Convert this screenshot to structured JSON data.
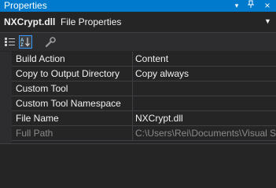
{
  "titlebar": {
    "title": "Properties",
    "menu_glyph": "▾",
    "pin_glyph": "⊥",
    "close_glyph": "×"
  },
  "selector": {
    "object_name": "NXCrypt.dll",
    "object_type": "File Properties",
    "dropdown_glyph": "▼"
  },
  "toolbar": {
    "tools": [
      "categorized-icon",
      "alphabetical-icon",
      "property-pages-icon"
    ],
    "active_tool": "alphabetical-icon",
    "active_color": "#3399ff"
  },
  "properties": [
    {
      "name": "Build Action",
      "value": "Content"
    },
    {
      "name": "Copy to Output Directory",
      "value": "Copy always"
    },
    {
      "name": "Custom Tool",
      "value": ""
    },
    {
      "name": "Custom Tool Namespace",
      "value": ""
    },
    {
      "name": "File Name",
      "value": "NXCrypt.dll"
    },
    {
      "name": "Full Path",
      "value": "C:\\Users\\Rei\\Documents\\Visual S"
    }
  ],
  "colors": {
    "titlebar": "#007acc",
    "background": "#252526",
    "gridline": "#3f3f46"
  }
}
